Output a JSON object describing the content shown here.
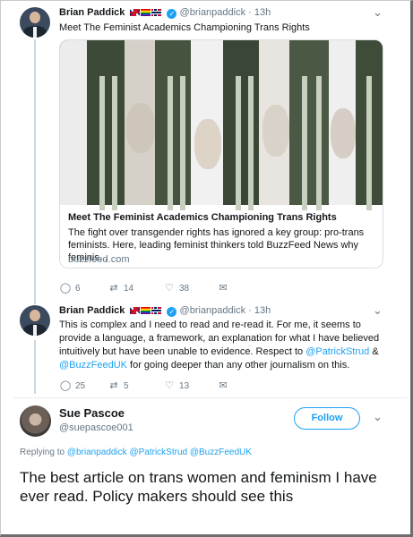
{
  "tweet1": {
    "name": "Brian Paddick",
    "handle": "@brianpaddick",
    "time": "· 13h",
    "text": "Meet The Feminist Academics Championing Trans Rights",
    "card": {
      "title": "Meet The Feminist Academics Championing Trans Rights",
      "description": "The fight over transgender rights has ignored a key group: pro-trans feminists. Here, leading feminist thinkers told BuzzFeed News why feminis...",
      "domain": "buzzfeed.com"
    },
    "actions": {
      "replies": "6",
      "retweets": "14",
      "likes": "38"
    }
  },
  "tweet2": {
    "name": "Brian Paddick",
    "handle": "@brianpaddick",
    "time": "· 13h",
    "text_part1": "This is complex and I need to read and re-read it. For me, it seems to provide a language, a framework, an explanation for what I have believed intuitively but have been unable to evidence. Respect to ",
    "mention1": "@PatrickStrud",
    "text_amp": " & ",
    "mention2": "@BuzzFeedUK",
    "text_part2": " for going deeper than any other journalism on this.",
    "actions": {
      "replies": "25",
      "retweets": "5",
      "likes": "13"
    }
  },
  "tweet3": {
    "name": "Sue Pascoe",
    "handle": "@suepascoe001",
    "follow_label": "Follow",
    "replying_prefix": "Replying to ",
    "replying_to": "@brianpaddick @PatrickStrud @BuzzFeedUK",
    "text": "The best article on trans women and feminism I have ever read. Policy makers should see this"
  },
  "icons": {
    "reply": "reply-icon",
    "retweet": "retweet-icon",
    "like": "heart-icon",
    "message": "envelope-icon",
    "chevron": "chevron-down-icon",
    "verified": "verified-badge-icon"
  },
  "colors": {
    "accent": "#1da1f2",
    "muted": "#657786",
    "thread": "#ccd6dd"
  }
}
